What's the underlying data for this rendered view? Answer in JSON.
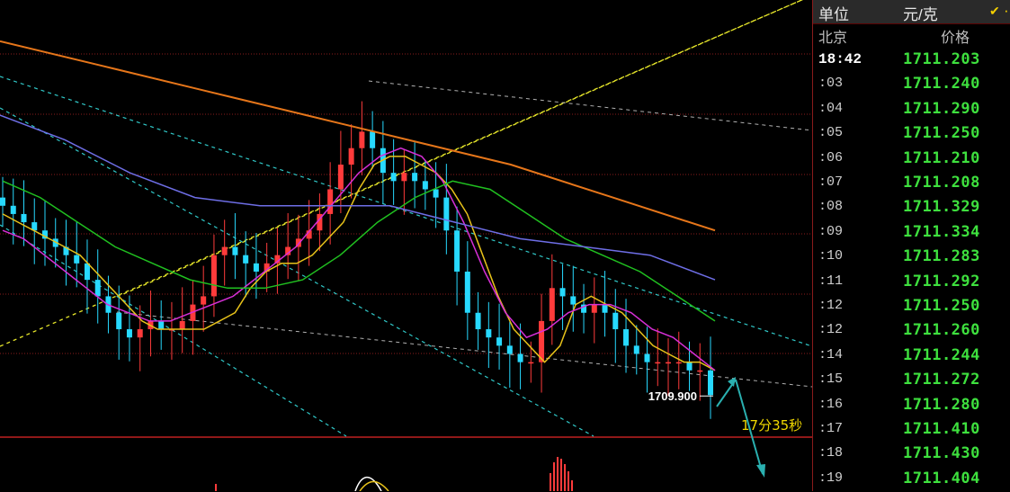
{
  "panel": {
    "unit_label": "单位",
    "unit_value": "元/克",
    "check_icon": "check-icon",
    "col_city": "北京",
    "col_price": "价格",
    "rows": [
      {
        "time": "18:42",
        "price": "1711.203"
      },
      {
        "time": ":03",
        "price": "1711.240"
      },
      {
        "time": ":04",
        "price": "1711.290"
      },
      {
        "time": ":05",
        "price": "1711.250"
      },
      {
        "time": ":06",
        "price": "1711.210"
      },
      {
        "time": ":07",
        "price": "1711.208"
      },
      {
        "time": ":08",
        "price": "1711.329"
      },
      {
        "time": ":09",
        "price": "1711.334"
      },
      {
        "time": ":10",
        "price": "1711.283"
      },
      {
        "time": ":11",
        "price": "1711.292"
      },
      {
        "time": ":12",
        "price": "1711.250"
      },
      {
        "time": ":12",
        "price": "1711.260"
      },
      {
        "time": ":14",
        "price": "1711.244"
      },
      {
        "time": ":15",
        "price": "1711.272"
      },
      {
        "time": ":16",
        "price": "1711.280"
      },
      {
        "time": ":17",
        "price": "1711.410"
      },
      {
        "time": ":18",
        "price": "1711.430"
      },
      {
        "time": ":19",
        "price": "1711.404"
      }
    ]
  },
  "colors": {
    "up": "#ff3b3b",
    "down": "#27d9ff",
    "price_text": "#3ee03e",
    "ma_yellow": "#e7c21a",
    "ma_magenta": "#d62fd6",
    "ma_green": "#20c020",
    "ma_blue": "#6e6ee6",
    "ma_orange": "#e6761a",
    "channel_yellow": "#e6e62a",
    "channel_cyan": "#30c8c8",
    "grid_red": "#8a1b1b"
  },
  "chart_data": {
    "type": "candlestick",
    "low_label": "1709.900",
    "annotation": "17分35秒",
    "closes": [
      1712.2,
      1712.1,
      1712.0,
      1711.9,
      1711.8,
      1711.7,
      1711.6,
      1711.5,
      1711.3,
      1711.1,
      1710.9,
      1710.7,
      1710.6,
      1710.7,
      1710.8,
      1710.7,
      1710.7,
      1710.8,
      1711.0,
      1711.1,
      1711.6,
      1711.7,
      1711.6,
      1711.5,
      1711.4,
      1711.5,
      1711.6,
      1711.7,
      1711.8,
      1711.9,
      1712.1,
      1712.4,
      1712.7,
      1712.9,
      1713.1,
      1712.9,
      1712.6,
      1712.5,
      1712.6,
      1712.5,
      1712.4,
      1712.3,
      1711.9,
      1711.4,
      1710.9,
      1710.7,
      1710.6,
      1710.5,
      1710.4,
      1710.3,
      1710.3,
      1710.8,
      1711.2,
      1711.1,
      1711.0,
      1710.9,
      1711.0,
      1710.9,
      1710.7,
      1710.5,
      1710.4,
      1710.3,
      1710.3,
      1710.3,
      1710.3,
      1710.2,
      1710.2,
      1709.9
    ],
    "ma_series": [
      {
        "color": "ma_yellow",
        "values": [
          1712.1,
          1712.0,
          1711.9,
          1711.8,
          1711.7,
          1711.6,
          1711.4,
          1711.2,
          1711.0,
          1710.8,
          1710.7,
          1710.7,
          1710.7,
          1710.7,
          1710.8,
          1710.9,
          1711.2,
          1711.4,
          1711.5,
          1711.5,
          1711.6,
          1711.8,
          1712.0,
          1712.4,
          1712.7,
          1712.8,
          1712.8,
          1712.7,
          1712.6,
          1712.4,
          1712.1,
          1711.6,
          1711.1,
          1710.7,
          1710.5,
          1710.3,
          1710.5,
          1711.0,
          1711.1,
          1711.0,
          1710.9,
          1710.7,
          1710.5,
          1710.4,
          1710.3,
          1710.3,
          1710.2
        ]
      },
      {
        "color": "ma_magenta",
        "values": [
          1711.9,
          1711.8,
          1711.6,
          1711.4,
          1711.2,
          1711.0,
          1710.9,
          1710.8,
          1710.8,
          1710.9,
          1711.0,
          1711.1,
          1711.3,
          1711.5,
          1711.7,
          1712.0,
          1712.3,
          1712.6,
          1712.8,
          1712.9,
          1712.8,
          1712.5,
          1712.0,
          1711.4,
          1710.9,
          1710.6,
          1710.7,
          1710.9,
          1711.0,
          1711.0,
          1710.9,
          1710.7,
          1710.6,
          1710.4,
          1710.2
        ]
      },
      {
        "color": "ma_green",
        "values": [
          1712.5,
          1712.3,
          1712.0,
          1711.7,
          1711.5,
          1711.3,
          1711.2,
          1711.2,
          1711.3,
          1711.6,
          1712.0,
          1712.3,
          1712.5,
          1712.4,
          1712.1,
          1711.8,
          1711.6,
          1711.4,
          1711.1,
          1710.8
        ]
      },
      {
        "color": "ma_blue",
        "values": [
          1713.3,
          1713.0,
          1712.6,
          1712.3,
          1712.2,
          1712.2,
          1712.2,
          1712.0,
          1711.8,
          1711.7,
          1711.6,
          1711.3
        ]
      },
      {
        "color": "ma_orange",
        "values": [
          1714.2,
          1713.9,
          1713.6,
          1713.3,
          1713.0,
          1712.7,
          1712.3,
          1711.9
        ]
      }
    ]
  }
}
